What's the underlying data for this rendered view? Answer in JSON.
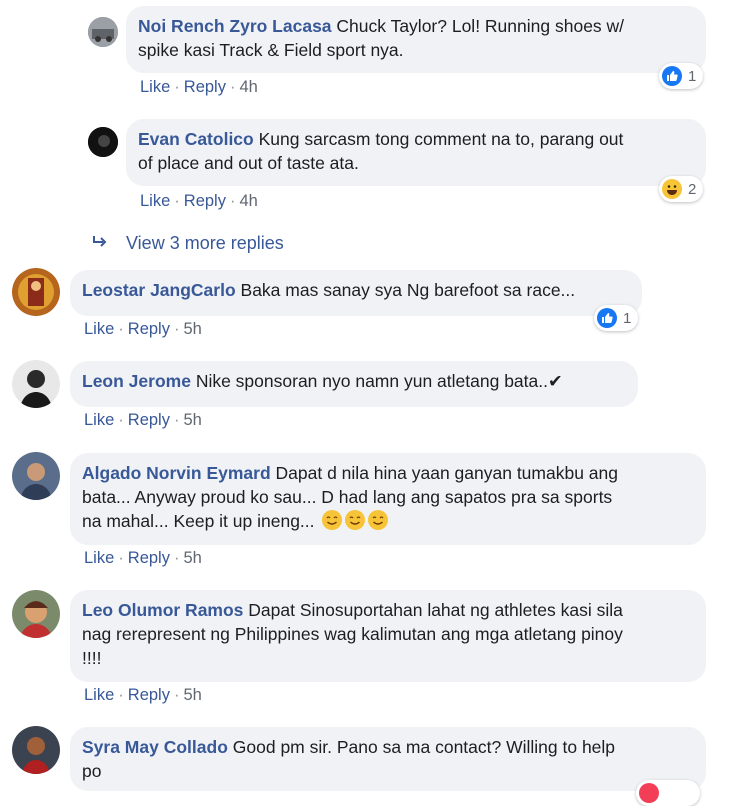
{
  "comments": [
    {
      "author": "Noi Rench Zyro Lacasa",
      "text_lines": [
        "Chuck Taylor? Lol! Running shoes w/",
        "spike kasi Track & Field sport nya."
      ],
      "like_label": "Like",
      "reply_label": "Reply",
      "time": "4h",
      "reaction": {
        "icon": "like-icon",
        "count": "1"
      }
    },
    {
      "author": "Evan Catolico",
      "text_lines": [
        "Kung sarcasm tong comment na to, parang out",
        "of place and out of taste ata."
      ],
      "like_label": "Like",
      "reply_label": "Reply",
      "time": "4h",
      "reaction": {
        "icon": "haha-icon",
        "count": "2"
      }
    },
    {
      "author": "Leostar JangCarlo",
      "text_lines": [
        "Baka mas sanay sya Ng barefoot sa race..."
      ],
      "like_label": "Like",
      "reply_label": "Reply",
      "time": "5h",
      "reaction": {
        "icon": "like-icon",
        "count": "1"
      }
    },
    {
      "author": "Leon Jerome",
      "text_lines": [
        "Nike sponsoran nyo namn yun atletang bata..✔"
      ],
      "like_label": "Like",
      "reply_label": "Reply",
      "time": "5h"
    },
    {
      "author": "Algado Norvin Eymard",
      "text_lines": [
        "Dapat d nila hina yaan ganyan tumakbu ang",
        "bata... Anyway proud ko sau... D had lang ang sapatos pra sa sports",
        "na mahal... Keep it up ineng..."
      ],
      "like_label": "Like",
      "reply_label": "Reply",
      "time": "5h"
    },
    {
      "author": "Leo Olumor Ramos",
      "text_lines": [
        "Dapat Sinosuportahan lahat ng athletes kasi sila",
        "nag rerepresent ng Philippines wag kalimutan ang mga atletang pinoy",
        "!!!!"
      ],
      "like_label": "Like",
      "reply_label": "Reply",
      "time": "5h"
    },
    {
      "author": "Syra May Collado",
      "text_lines": [
        "Good pm sir. Pano sa ma contact? Willing to help",
        "po"
      ]
    }
  ],
  "view_more": {
    "label": "View 3 more replies",
    "icon": "reply-arrow-icon"
  },
  "separator": "·",
  "colors": {
    "link": "#385898",
    "bubble": "#f0f2f5",
    "like_blue": "#1877f2",
    "haha_yellow": "#f7c438"
  }
}
